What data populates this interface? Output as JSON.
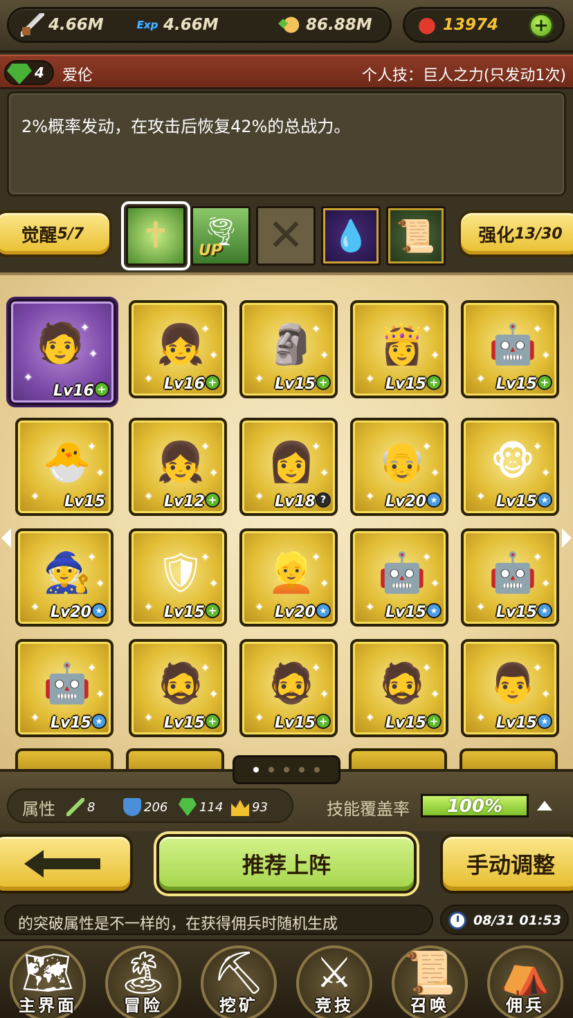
{
  "resources": {
    "attack": "4.66M",
    "exp": "4.66M",
    "gold": "86.88M",
    "ruby": "13974",
    "exp_icon_text": "Exp"
  },
  "hero": {
    "level": "4",
    "name": "爱伦",
    "skill_title": "个人技：巨人之力(只发动1次)",
    "skill_desc": "2%概率发动，在攻击后恢复42%的总战力。"
  },
  "talents": {
    "awaken_label": "觉醒",
    "awaken_value": "5/7",
    "enhance_label": "强化",
    "enhance_value": "13/30",
    "up_text": "UP",
    "slots": [
      {
        "icon": "staff-cross-icon",
        "selected": true
      },
      {
        "icon": "tornado-up-icon",
        "selected": false
      },
      {
        "icon": "empty-slot-icon",
        "selected": false
      },
      {
        "icon": "blood-drop-icon",
        "selected": false
      },
      {
        "icon": "scroll-icon",
        "selected": false
      }
    ]
  },
  "cards": [
    {
      "lv": "Lv16",
      "badge": "plus",
      "sprite": "🧑",
      "variant": "purple"
    },
    {
      "lv": "Lv16",
      "badge": "plus",
      "sprite": "👧",
      "variant": "gold"
    },
    {
      "lv": "Lv15",
      "badge": "plus",
      "sprite": "🗿",
      "variant": "gold"
    },
    {
      "lv": "Lv15",
      "badge": "plus",
      "sprite": "👸",
      "variant": "gold"
    },
    {
      "lv": "Lv15",
      "badge": "plus",
      "sprite": "🤖",
      "variant": "gold"
    },
    {
      "lv": "Lv15",
      "badge": "none",
      "sprite": "🐣",
      "variant": "gold"
    },
    {
      "lv": "Lv12",
      "badge": "plus",
      "sprite": "👧",
      "variant": "gold"
    },
    {
      "lv": "Lv18",
      "badge": "question",
      "sprite": "👩",
      "variant": "gold"
    },
    {
      "lv": "Lv20",
      "badge": "star",
      "sprite": "👴",
      "variant": "gold"
    },
    {
      "lv": "Lv15",
      "badge": "star",
      "sprite": "🐵",
      "variant": "gold"
    },
    {
      "lv": "Lv20",
      "badge": "star",
      "sprite": "🧙",
      "variant": "gold"
    },
    {
      "lv": "Lv15",
      "badge": "plus",
      "sprite": "🛡",
      "variant": "gold"
    },
    {
      "lv": "Lv20",
      "badge": "star",
      "sprite": "👱",
      "variant": "gold"
    },
    {
      "lv": "Lv15",
      "badge": "star",
      "sprite": "🤖",
      "variant": "gold"
    },
    {
      "lv": "Lv15",
      "badge": "star",
      "sprite": "🤖",
      "variant": "gold"
    },
    {
      "lv": "Lv15",
      "badge": "star",
      "sprite": "🤖",
      "variant": "gold"
    },
    {
      "lv": "Lv15",
      "badge": "plus",
      "sprite": "🧔",
      "variant": "gold"
    },
    {
      "lv": "Lv15",
      "badge": "plus",
      "sprite": "🧔",
      "variant": "gold"
    },
    {
      "lv": "Lv15",
      "badge": "plus",
      "sprite": "🧔",
      "variant": "gold"
    },
    {
      "lv": "Lv15",
      "badge": "star",
      "sprite": "👨",
      "variant": "gold"
    }
  ],
  "pagination": {
    "total": 5,
    "active": 0
  },
  "stats": {
    "label": "属性",
    "staff": "8",
    "defense": "206",
    "gem": "114",
    "crown": "93",
    "coverage_label": "技能覆盖率",
    "coverage_text": "100%",
    "coverage_value": 1.0
  },
  "actions": {
    "recommend": "推荐上阵",
    "manual": "手动调整"
  },
  "ticker": {
    "text": "的突破属性是不一样的，在获得佣兵时随机生成",
    "time": "08/31 01:53"
  },
  "nav": [
    {
      "label": "主界面",
      "icon": "map-icon",
      "glyph": "🗺"
    },
    {
      "label": "冒险",
      "icon": "island-icon",
      "glyph": "🏝"
    },
    {
      "label": "挖矿",
      "icon": "pickaxe-icon",
      "glyph": "⛏"
    },
    {
      "label": "竞技",
      "icon": "crossed-swords-icon",
      "glyph": "⚔"
    },
    {
      "label": "召唤",
      "icon": "scroll-icon",
      "glyph": "📜"
    },
    {
      "label": "佣兵",
      "icon": "tent-icon",
      "glyph": "⛺"
    }
  ]
}
